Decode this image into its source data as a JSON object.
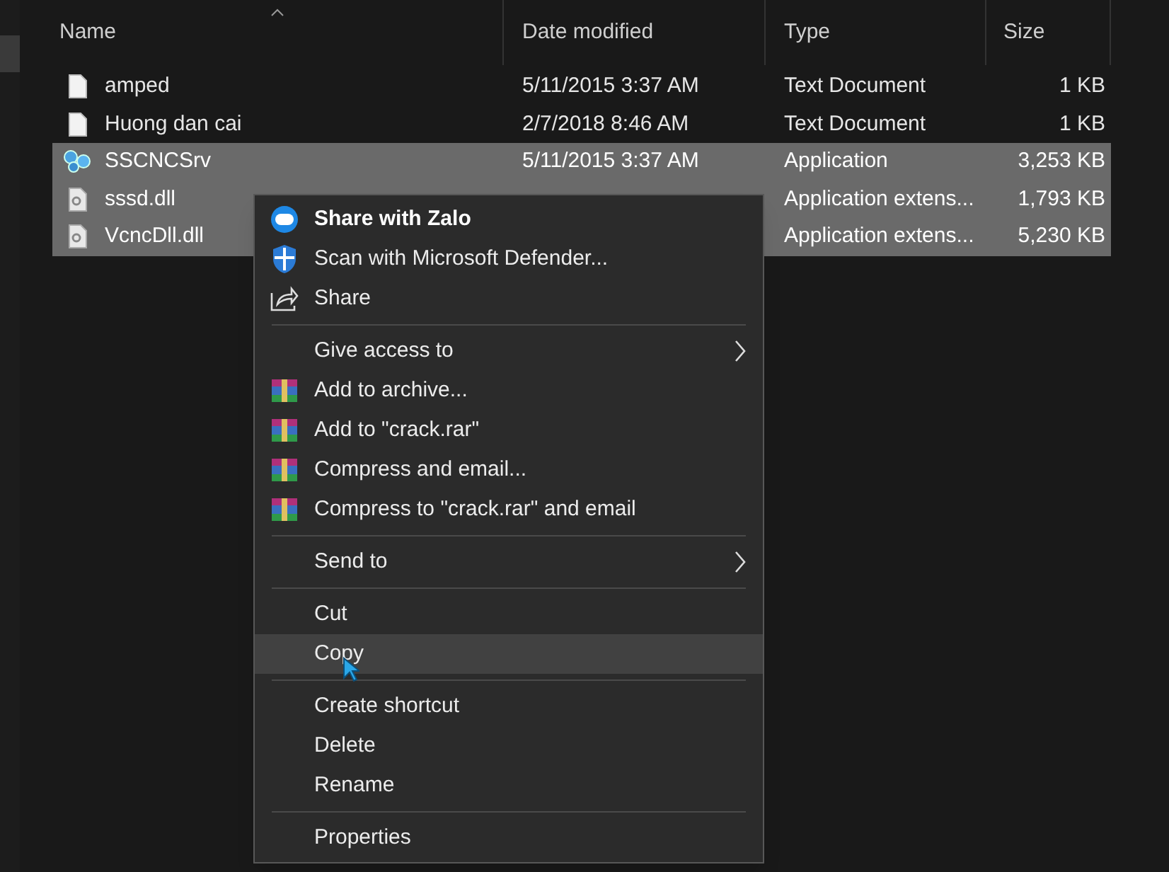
{
  "file_list": {
    "columns": [
      {
        "label": "Name",
        "sorted": true
      },
      {
        "label": "Date modified",
        "sorted": false
      },
      {
        "label": "Type",
        "sorted": false
      },
      {
        "label": "Size",
        "sorted": false
      }
    ],
    "rows": [
      {
        "kind": "text",
        "name": "amped",
        "date": "5/11/2015 3:37 AM",
        "type": "Text Document",
        "size": "1 KB",
        "selected": false
      },
      {
        "kind": "text",
        "name": "Huong dan cai",
        "date": "2/7/2018 8:46 AM",
        "type": "Text Document",
        "size": "1 KB",
        "selected": false
      },
      {
        "kind": "app",
        "name": "SSCNCSrv",
        "date": "5/11/2015 3:37 AM",
        "type": "Application",
        "size": "3,253 KB",
        "selected": true
      },
      {
        "kind": "dll",
        "name": "sssd.dll",
        "type": "Application extens...",
        "size": "1,793 KB",
        "selected": true
      },
      {
        "kind": "dll",
        "name": "VcncDll.dll",
        "type": "Application extens...",
        "size": "5,230 KB",
        "selected": true
      }
    ]
  },
  "context_menu": {
    "items": [
      {
        "kind": "zalo",
        "label": "Share with Zalo",
        "bold": true,
        "submenu": false,
        "selected": false
      },
      {
        "kind": "defender",
        "label": "Scan with Microsoft Defender...",
        "bold": false,
        "submenu": false,
        "selected": false
      },
      {
        "kind": "share",
        "label": "Share",
        "bold": false,
        "submenu": false,
        "selected": false
      },
      {
        "kind": "separator"
      },
      {
        "kind": "plain",
        "label": "Give access to",
        "bold": false,
        "submenu": true,
        "selected": false
      },
      {
        "kind": "archive",
        "label": "Add to archive...",
        "bold": false,
        "submenu": false,
        "selected": false
      },
      {
        "kind": "archive",
        "label": "Add to \"crack.rar\"",
        "bold": false,
        "submenu": false,
        "selected": false
      },
      {
        "kind": "archive",
        "label": "Compress and email...",
        "bold": false,
        "submenu": false,
        "selected": false
      },
      {
        "kind": "archive",
        "label": "Compress to \"crack.rar\" and email",
        "bold": false,
        "submenu": false,
        "selected": false
      },
      {
        "kind": "separator"
      },
      {
        "kind": "plain",
        "label": "Send to",
        "bold": false,
        "submenu": true,
        "selected": false
      },
      {
        "kind": "separator"
      },
      {
        "kind": "plain",
        "label": "Cut",
        "bold": false,
        "submenu": false,
        "selected": false
      },
      {
        "kind": "plain",
        "label": "Copy",
        "bold": false,
        "submenu": false,
        "selected": true
      },
      {
        "kind": "separator"
      },
      {
        "kind": "plain",
        "label": "Create shortcut",
        "bold": false,
        "submenu": false,
        "selected": false
      },
      {
        "kind": "plain",
        "label": "Delete",
        "bold": false,
        "submenu": false,
        "selected": false
      },
      {
        "kind": "plain",
        "label": "Rename",
        "bold": false,
        "submenu": false,
        "selected": false
      },
      {
        "kind": "separator"
      },
      {
        "kind": "plain",
        "label": "Properties",
        "bold": false,
        "submenu": false,
        "selected": false
      }
    ]
  }
}
